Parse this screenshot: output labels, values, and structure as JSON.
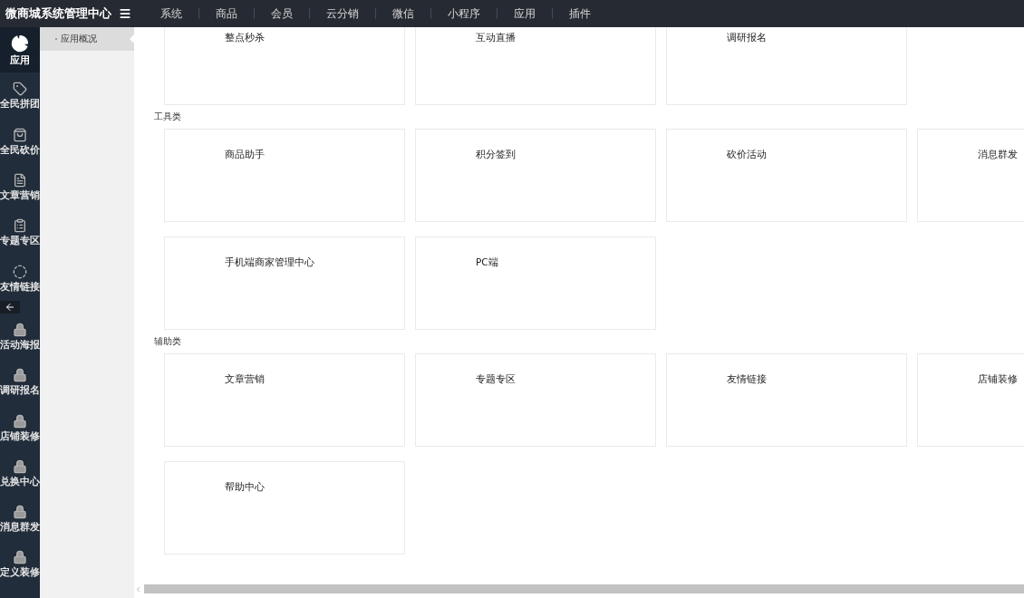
{
  "brand": "微商城系统管理中心",
  "nav": [
    "系统",
    "商品",
    "会员",
    "云分销",
    "微信",
    "小程序",
    "应用",
    "插件"
  ],
  "sidebar": [
    {
      "label": "应用",
      "kind": "pie",
      "selected": true
    },
    {
      "label": "全民拼团",
      "kind": "tag",
      "selected": false
    },
    {
      "label": "全民砍价",
      "kind": "bag",
      "selected": false
    },
    {
      "label": "文章营销",
      "kind": "document",
      "selected": false
    },
    {
      "label": "专题专区",
      "kind": "clipboard",
      "selected": false
    },
    {
      "label": "友情链接",
      "kind": "ring",
      "selected": false
    },
    {
      "label": "活动海报",
      "kind": "lock",
      "selected": false
    },
    {
      "label": "调研报名",
      "kind": "lock",
      "selected": false
    },
    {
      "label": "店铺装修",
      "kind": "lock",
      "selected": false
    },
    {
      "label": "兑换中心",
      "kind": "lock",
      "selected": false
    },
    {
      "label": "消息群发",
      "kind": "lock",
      "selected": false
    },
    {
      "label": "定义装修",
      "kind": "lock",
      "selected": false
    }
  ],
  "subnav": [
    {
      "label": "应用概况",
      "selected": true
    }
  ],
  "sections": [
    {
      "cards": [
        "整点秒杀",
        "互动直播",
        "调研报名"
      ]
    },
    {
      "title": "工具类",
      "cards": [
        "商品助手",
        "积分签到",
        "砍价活动",
        "消息群发",
        "手机端商家管理中心",
        "PC端"
      ]
    },
    {
      "title": "辅助类",
      "cards": [
        "文章营销",
        "专题专区",
        "友情链接",
        "店铺装修",
        "帮助中心"
      ]
    }
  ]
}
